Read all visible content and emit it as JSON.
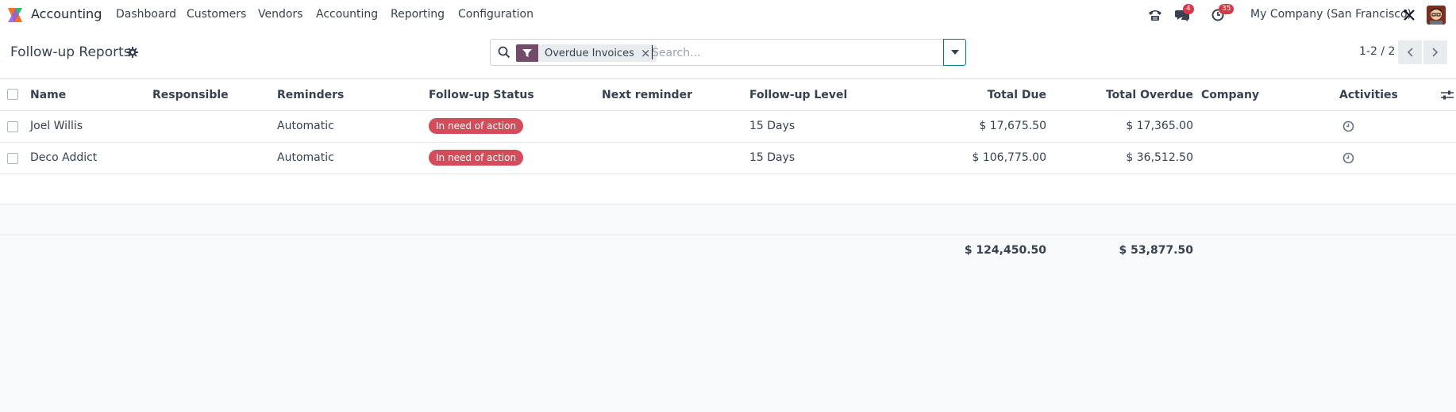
{
  "app": {
    "name": "Accounting"
  },
  "menu": [
    "Dashboard",
    "Customers",
    "Vendors",
    "Accounting",
    "Reporting",
    "Configuration"
  ],
  "systray": {
    "messages_count": "4",
    "activities_count": "35",
    "company": "My Company (San Francisco)"
  },
  "control": {
    "title": "Follow-up Reports",
    "facet_label": "Overdue Invoices",
    "search_placeholder": "Search...",
    "pager": "1-2 / 2"
  },
  "table": {
    "headers": {
      "name": "Name",
      "responsible": "Responsible",
      "reminders": "Reminders",
      "status": "Follow-up Status",
      "next_reminder": "Next reminder",
      "level": "Follow-up Level",
      "total_due": "Total Due",
      "total_overdue": "Total Overdue",
      "company": "Company",
      "activities": "Activities"
    },
    "rows": [
      {
        "name": "Joel Willis",
        "responsible": "",
        "reminders": "Automatic",
        "status": "In need of action",
        "next_reminder": "",
        "level": "15 Days",
        "total_due": "$ 17,675.50",
        "total_overdue": "$ 17,365.00",
        "company": ""
      },
      {
        "name": "Deco Addict",
        "responsible": "",
        "reminders": "Automatic",
        "status": "In need of action",
        "next_reminder": "",
        "level": "15 Days",
        "total_due": "$ 106,775.00",
        "total_overdue": "$ 36,512.50",
        "company": ""
      }
    ],
    "totals": {
      "total_due": "$ 124,450.50",
      "total_overdue": "$ 53,877.50"
    }
  },
  "colors": {
    "brand": "#714b67",
    "status_badge": "#d44c59",
    "accent": "#017e84",
    "notification": "#dc3545"
  }
}
